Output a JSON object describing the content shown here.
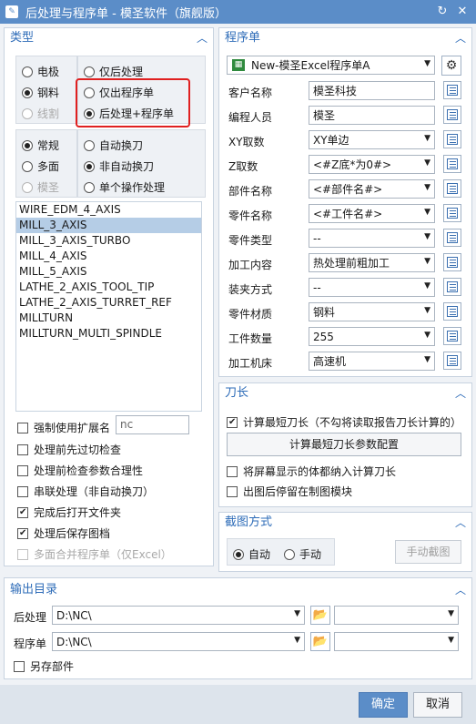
{
  "window": {
    "title": "后处理与程序单 - 模圣软件（旗舰版）"
  },
  "type_panel": {
    "header": "类型",
    "machine_radios": [
      {
        "label": "电极",
        "checked": false,
        "disabled": false
      },
      {
        "label": "钢料",
        "checked": true,
        "disabled": false
      },
      {
        "label": "线割",
        "checked": false,
        "disabled": true
      }
    ],
    "output_radios": [
      {
        "label": "仅后处理",
        "checked": false
      },
      {
        "label": "仅出程序单",
        "checked": false
      },
      {
        "label": "后处理+程序单",
        "checked": true
      }
    ],
    "mode_radios": [
      {
        "label": "常规",
        "checked": true,
        "disabled": false
      },
      {
        "label": "多面",
        "checked": false,
        "disabled": false
      },
      {
        "label": "模圣",
        "checked": false,
        "disabled": true
      }
    ],
    "toolchange_radios": [
      {
        "label": "自动换刀",
        "checked": false
      },
      {
        "label": "非自动换刀",
        "checked": true
      },
      {
        "label": "单个操作处理",
        "checked": false
      }
    ],
    "postprocessors": [
      "WIRE_EDM_4_AXIS",
      "MILL_3_AXIS",
      "MILL_3_AXIS_TURBO",
      "MILL_4_AXIS",
      "MILL_5_AXIS",
      "LATHE_2_AXIS_TOOL_TIP",
      "LATHE_2_AXIS_TURRET_REF",
      "MILLTURN",
      "MILLTURN_MULTI_SPINDLE"
    ],
    "selected_postprocessor": "MILL_3_AXIS",
    "force_extension_label": "强制使用扩展名",
    "extension_value": "nc",
    "options": [
      {
        "label": "处理前先过切检查",
        "checked": false,
        "disabled": false
      },
      {
        "label": "处理前检查参数合理性",
        "checked": false,
        "disabled": false
      },
      {
        "label": "串联处理（非自动换刀）",
        "checked": false,
        "disabled": false
      },
      {
        "label": "完成后打开文件夹",
        "checked": true,
        "disabled": false
      },
      {
        "label": "处理后保存图档",
        "checked": true,
        "disabled": false
      },
      {
        "label": "多面合并程序单（仅Excel）",
        "checked": false,
        "disabled": true
      }
    ]
  },
  "program_panel": {
    "header": "程序单",
    "template": "New-模圣Excel程序单A",
    "fields": [
      {
        "label": "客户名称",
        "value": "模圣科技",
        "dropdown": false
      },
      {
        "label": "编程人员",
        "value": "模圣",
        "dropdown": false
      },
      {
        "label": "XY取数",
        "value": "XY单边",
        "dropdown": true
      },
      {
        "label": "Z取数",
        "value": "<#Z底*为0#>",
        "dropdown": true
      },
      {
        "label": "部件名称",
        "value": "<#部件名#>",
        "dropdown": true
      },
      {
        "label": "零件名称",
        "value": "<#工件名#>",
        "dropdown": true
      },
      {
        "label": "零件类型",
        "value": "--",
        "dropdown": true
      },
      {
        "label": "加工内容",
        "value": "热处理前粗加工",
        "dropdown": true
      },
      {
        "label": "装夹方式",
        "value": "--",
        "dropdown": true
      },
      {
        "label": "零件材质",
        "value": "钢料",
        "dropdown": true
      },
      {
        "label": "工件数量",
        "value": "255",
        "dropdown": true
      },
      {
        "label": "加工机床",
        "value": "高速机",
        "dropdown": true
      }
    ]
  },
  "tool_panel": {
    "header": "刀长",
    "calc_shortest_label": "计算最短刀长（不勾将读取报告刀长计算的）",
    "calc_shortest_checked": true,
    "config_button": "计算最短刀长参数配置",
    "include_screen_bodies": "将屏幕显示的体都纳入计算刀长",
    "stay_in_drawing": "出图后停留在制图模块"
  },
  "capture_panel": {
    "header": "截图方式",
    "auto_label": "自动",
    "manual_label": "手动",
    "auto_checked": true,
    "manual_button": "手动截图"
  },
  "output_panel": {
    "header": "输出目录",
    "post_label": "后处理",
    "post_path": "D:\\NC\\",
    "sheet_label": "程序单",
    "sheet_path": "D:\\NC\\",
    "save_part_label": "另存部件"
  },
  "footer": {
    "ok": "确定",
    "cancel": "取消"
  }
}
